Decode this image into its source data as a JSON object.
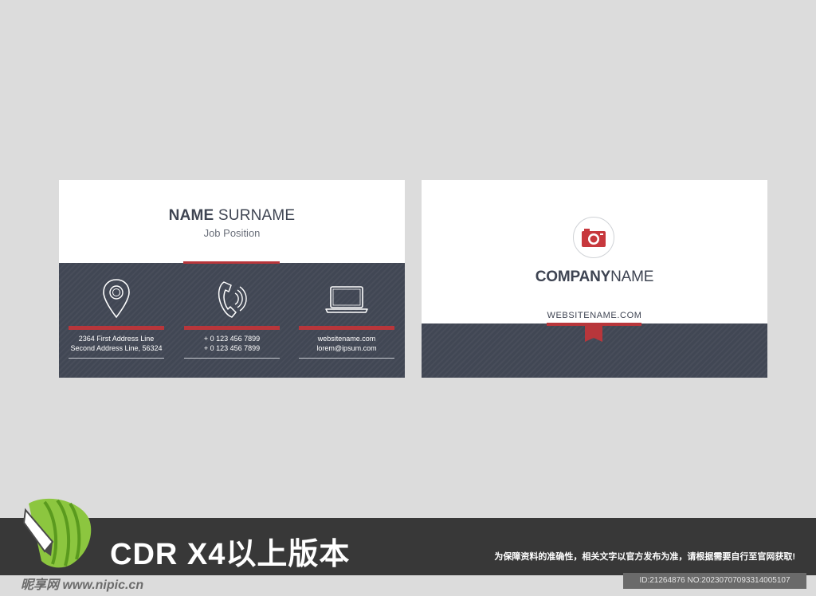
{
  "front": {
    "name_bold": "NAME",
    "name_rest": " SURNAME",
    "job": "Job Position",
    "columns": [
      {
        "icon": "location-pin-icon",
        "line1": "2364 First Address Line",
        "line2": "Second Address Line, 56324"
      },
      {
        "icon": "phone-icon",
        "line1": "+ 0 123 456 7899",
        "line2": "+ 0 123 456 7899"
      },
      {
        "icon": "laptop-icon",
        "line1": "websitename.com",
        "line2": "lorem@ipsum.com"
      }
    ]
  },
  "back": {
    "logo_icon": "camera-icon",
    "company_bold": "COMPANY",
    "company_rest": "NAME",
    "website": "WEBSITENAME.COM"
  },
  "banner": {
    "title": "CDR X4以上版本",
    "note": "为保障资料的准确性，相关文字以官方发布为准，请根据需要自行至官网获取!",
    "id_text": "ID:21264876 NO:20230707093314005107",
    "watermark": "昵享网 www.nipic.cn"
  },
  "colors": {
    "background": "#dcdcdc",
    "dark": "#414754",
    "accent": "#b8363b",
    "banner": "#383838"
  }
}
